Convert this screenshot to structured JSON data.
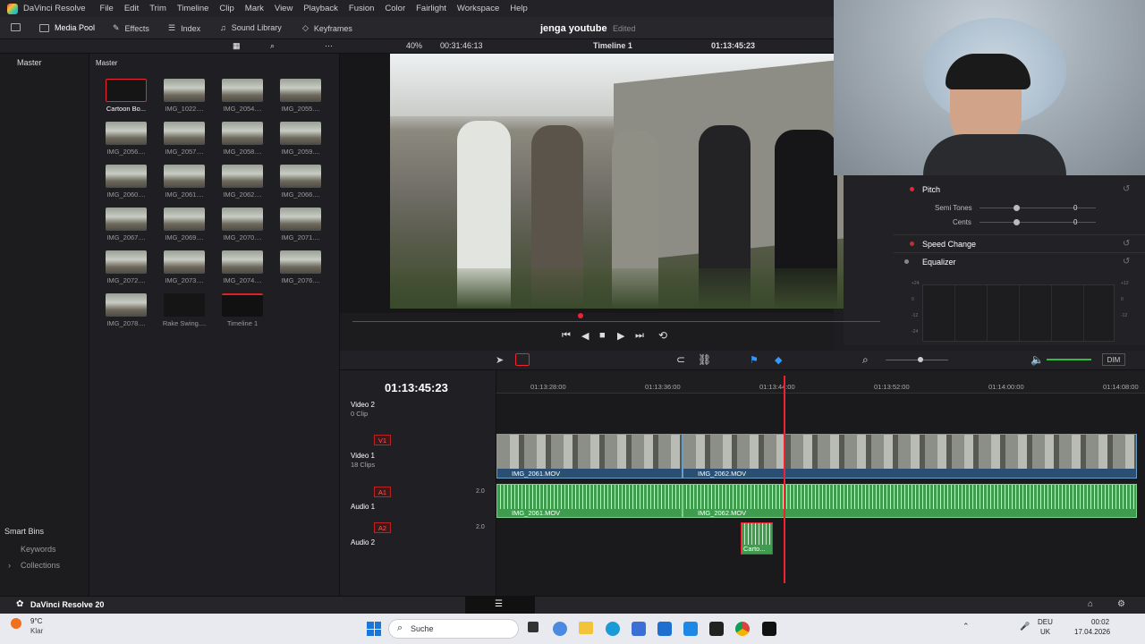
{
  "app": {
    "name": "DaVinci Resolve",
    "footer_name": "DaVinci Resolve 20"
  },
  "menu": [
    "File",
    "Edit",
    "Trim",
    "Timeline",
    "Clip",
    "Mark",
    "View",
    "Playback",
    "Fusion",
    "Color",
    "Fairlight",
    "Workspace",
    "Help"
  ],
  "toolbar": {
    "media_pool": "Media Pool",
    "effects": "Effects",
    "index": "Index",
    "sound_library": "Sound Library",
    "keyframes": "Keyframes"
  },
  "project": {
    "title": "jenga youtube",
    "status": "Edited"
  },
  "viewer": {
    "zoom": "40%",
    "source_timecode": "00:31:46:13",
    "timeline_name": "Timeline 1",
    "record_timecode": "01:13:45:23"
  },
  "left_nav": {
    "master": "Master",
    "smart_bins": "Smart Bins",
    "keywords": "Keywords",
    "collections": "Collections"
  },
  "media_pool": {
    "bin": "Master",
    "clips": [
      "Cartoon Bo...",
      "IMG_1022....",
      "IMG_2054....",
      "IMG_2055....",
      "IMG_2056....",
      "IMG_2057....",
      "IMG_2058....",
      "IMG_2059....",
      "IMG_2060....",
      "IMG_2061....",
      "IMG_2062....",
      "IMG_2066....",
      "IMG_2067....",
      "IMG_2069....",
      "IMG_2070....",
      "IMG_2071....",
      "IMG_2072....",
      "IMG_2073....",
      "IMG_2074....",
      "IMG_2076....",
      "IMG_2078....",
      "Rake Swing....",
      "Timeline 1"
    ]
  },
  "inspector": {
    "pitch": "Pitch",
    "semi_tones": "Semi Tones",
    "semi_value": "0",
    "cents": "Cents",
    "cents_value": "0",
    "speed_change": "Speed Change",
    "equalizer": "Equalizer",
    "eq_db": [
      "+24",
      "0",
      "-12",
      "-24",
      "+12",
      "0",
      "-12"
    ]
  },
  "timeline": {
    "timecode": "01:13:45:23",
    "ruler": [
      "01:13:28:00",
      "01:13:36:00",
      "01:13:44:00",
      "01:13:52:00",
      "01:14:00:00",
      "01:14:08:00"
    ],
    "tracks": {
      "video2": {
        "name": "Video 2",
        "count": "0 Clip"
      },
      "video1": {
        "badge": "V1",
        "name": "Video 1",
        "count": "18 Clips"
      },
      "audio1": {
        "badge": "A1",
        "name": "Audio 1",
        "level": "2.0"
      },
      "audio2": {
        "badge": "A2",
        "name": "Audio 2",
        "level": "2.0"
      }
    },
    "clips": {
      "v1a": "IMG_2061.MOV",
      "v1b": "IMG_2062.MOV",
      "a1a": "IMG_2061.MOV",
      "a1b": "IMG_2062.MOV",
      "a2": "Carto..."
    },
    "dim": "DIM"
  },
  "taskbar": {
    "weather_temp": "9°C",
    "weather_text": "Klar",
    "search": "Suche",
    "lang1": "DEU",
    "lang2": "UK",
    "time": "00:02",
    "date": "17.04.2026"
  },
  "colors": {
    "accent_red": "#e22233",
    "clip_blue": "#2a4f73",
    "clip_green": "#3f9b4e"
  }
}
